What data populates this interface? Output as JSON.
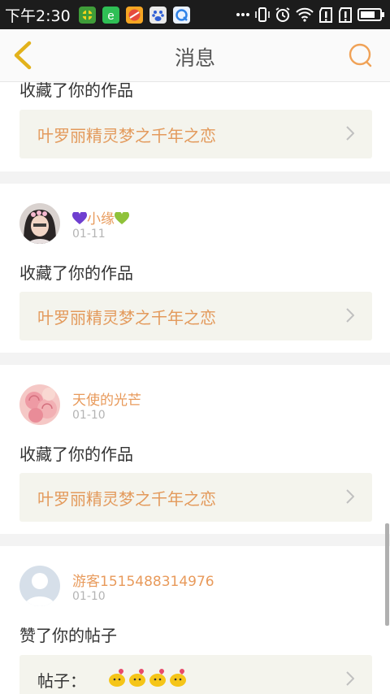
{
  "status_bar": {
    "time": "下午2:30"
  },
  "header": {
    "title": "消息",
    "back_icon": "chevron-left-icon",
    "search_icon": "search-icon"
  },
  "items": [
    {
      "action": "收藏了你的作品",
      "ref_title": "叶罗丽精灵梦之千年之恋"
    },
    {
      "user": "小缘",
      "date": "01-11",
      "action": "收藏了你的作品",
      "ref_title": "叶罗丽精灵梦之千年之恋"
    },
    {
      "user": "天使的光芒",
      "date": "01-10",
      "action": "收藏了你的作品",
      "ref_title": "叶罗丽精灵梦之千年之恋"
    },
    {
      "user": "游客1515488314976",
      "date": "01-10",
      "action": "赞了你的帖子",
      "ref_title": "帖子："
    }
  ],
  "colors": {
    "accent": "#e89a5b",
    "header_icon": "#e2b21c",
    "heart_left": "#6f3fd0",
    "heart_right": "#8fc23a"
  }
}
